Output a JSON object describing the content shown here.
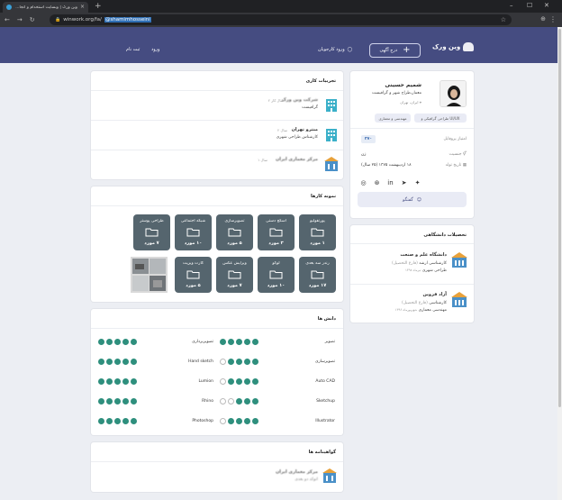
{
  "browser": {
    "tab_title": "وین ورک | وبسایت استخدام و انجا...",
    "url_prefix": "winwork.org/fa/",
    "url_selected": "@shamimhosseini"
  },
  "header": {
    "logo_text": "وین ورک",
    "post_button": "درج آگهی",
    "employer_login": "ورود کارجویان",
    "login": "ورود",
    "register": "ثبت نام",
    "colors": {
      "header_bg": "#454c81",
      "accent": "#2e8f7d",
      "tile": "#55656e"
    }
  },
  "profile": {
    "name": "شمیم حسینی",
    "title": "معمار،طراح شهر و گرافیست",
    "location": "ایران، تهران",
    "chips": [
      "طراحی گرافیکی و UI/UX",
      "مهندسی و معماری"
    ],
    "views_label": "امتیاز پروفایل",
    "views_value": "۲۷۰",
    "gender_label": "جنسیت",
    "gender_value": "زن",
    "birth_label": "تاریخ تولد",
    "birth_value": "۱۸ اردیبهشت ۱۳۷۵ (۲۵ سال)",
    "chat_button": "گفتگو",
    "social_icons": [
      "instagram-icon",
      "dribbble-icon",
      "linkedin-icon",
      "telegram-icon",
      "twitter-icon"
    ]
  },
  "education": {
    "title": "تحصیلات دانشگاهی",
    "items": [
      {
        "name": "دانشگاه علم و صنعت",
        "degree": "کارشناسی ارشد",
        "status": "(فارغ التحصیل)",
        "field": "طراحی شهری",
        "year": "تیرماه ۱۳۹۸"
      },
      {
        "name": "آزاد قزوین",
        "degree": "کارشناسی",
        "status": "(فارغ التحصیل)",
        "field": "مهندسی معماری",
        "year": "شهریورماه ۱۳۹۶"
      }
    ]
  },
  "experience": {
    "title": "تجربیات کاری",
    "items": [
      {
        "company": "شرکت وین ورک",
        "role": "گرافیست",
        "date": "۲ سال کار"
      },
      {
        "company": "منترو تهران",
        "role": "کارشناس طراحی شهری",
        "date": "۲ سال"
      },
      {
        "company": "مرکز معماری ایران",
        "role": "",
        "date": "۱ سال"
      }
    ]
  },
  "portfolio": {
    "title": "نمونه کارها",
    "row1": [
      {
        "label": "پورتفولیو",
        "count": "۱ مورد"
      },
      {
        "label": "اسکچ دستی",
        "count": "۳ مورد"
      },
      {
        "label": "تصویرسازی",
        "count": "۵ مورد"
      },
      {
        "label": "شبکه اجتماعی",
        "count": "۱۰ مورد"
      },
      {
        "label": "طراحی پوستر",
        "count": "۷ مورد"
      }
    ],
    "row2": [
      {
        "label": "رندر سه بعدی",
        "count": "۱۷ مورد"
      },
      {
        "label": "لوگو",
        "count": "۱۰ مورد"
      },
      {
        "label": "ویرایش عکس",
        "count": "۷ مورد"
      },
      {
        "label": "کارت ویزیت",
        "count": "۵ مورد"
      }
    ]
  },
  "skills": {
    "title": "دانش ها",
    "right": [
      {
        "name": "تصویر",
        "level": 5
      },
      {
        "name": "تصویرسازی",
        "level": 4
      },
      {
        "name": "Auto CAD",
        "level": 4
      },
      {
        "name": "Sketchup",
        "level": 3
      },
      {
        "name": "Illustrator",
        "level": 4
      }
    ],
    "left": [
      {
        "name": "تصویربرداری",
        "level": 5
      },
      {
        "name": "Hand sketch",
        "level": 5
      },
      {
        "name": "Lumion",
        "level": 5
      },
      {
        "name": "Rhino",
        "level": 5
      },
      {
        "name": "Photoshop",
        "level": 5
      }
    ]
  },
  "certificates": {
    "title": "گواهینامه ها",
    "items": [
      {
        "name": "مرکز معماری ایران",
        "sub": "اتوکد دو بعدی"
      }
    ]
  }
}
